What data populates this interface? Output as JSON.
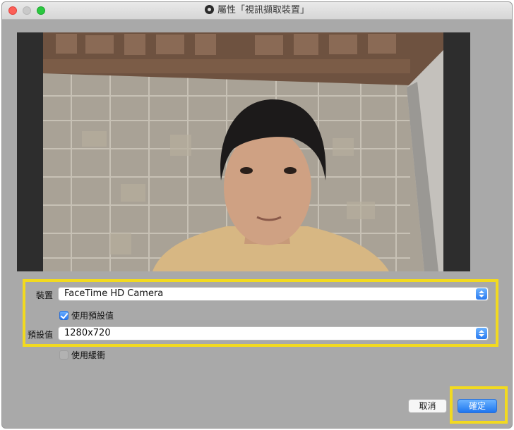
{
  "window": {
    "title": "屬性「視訊擷取裝置」"
  },
  "form": {
    "device": {
      "label": "裝置",
      "value": "FaceTime HD Camera"
    },
    "use_preset": {
      "label": "使用預設值",
      "checked": true
    },
    "preset": {
      "label": "預設值",
      "value": "1280x720"
    },
    "use_buffering": {
      "label": "使用緩衝",
      "checked": false
    }
  },
  "buttons": {
    "cancel_label": "取消",
    "ok_label": "確定"
  },
  "colors": {
    "highlight": "#f2da1f",
    "accent": "#2b7bf0",
    "window_bg": "#a9a9a9"
  }
}
